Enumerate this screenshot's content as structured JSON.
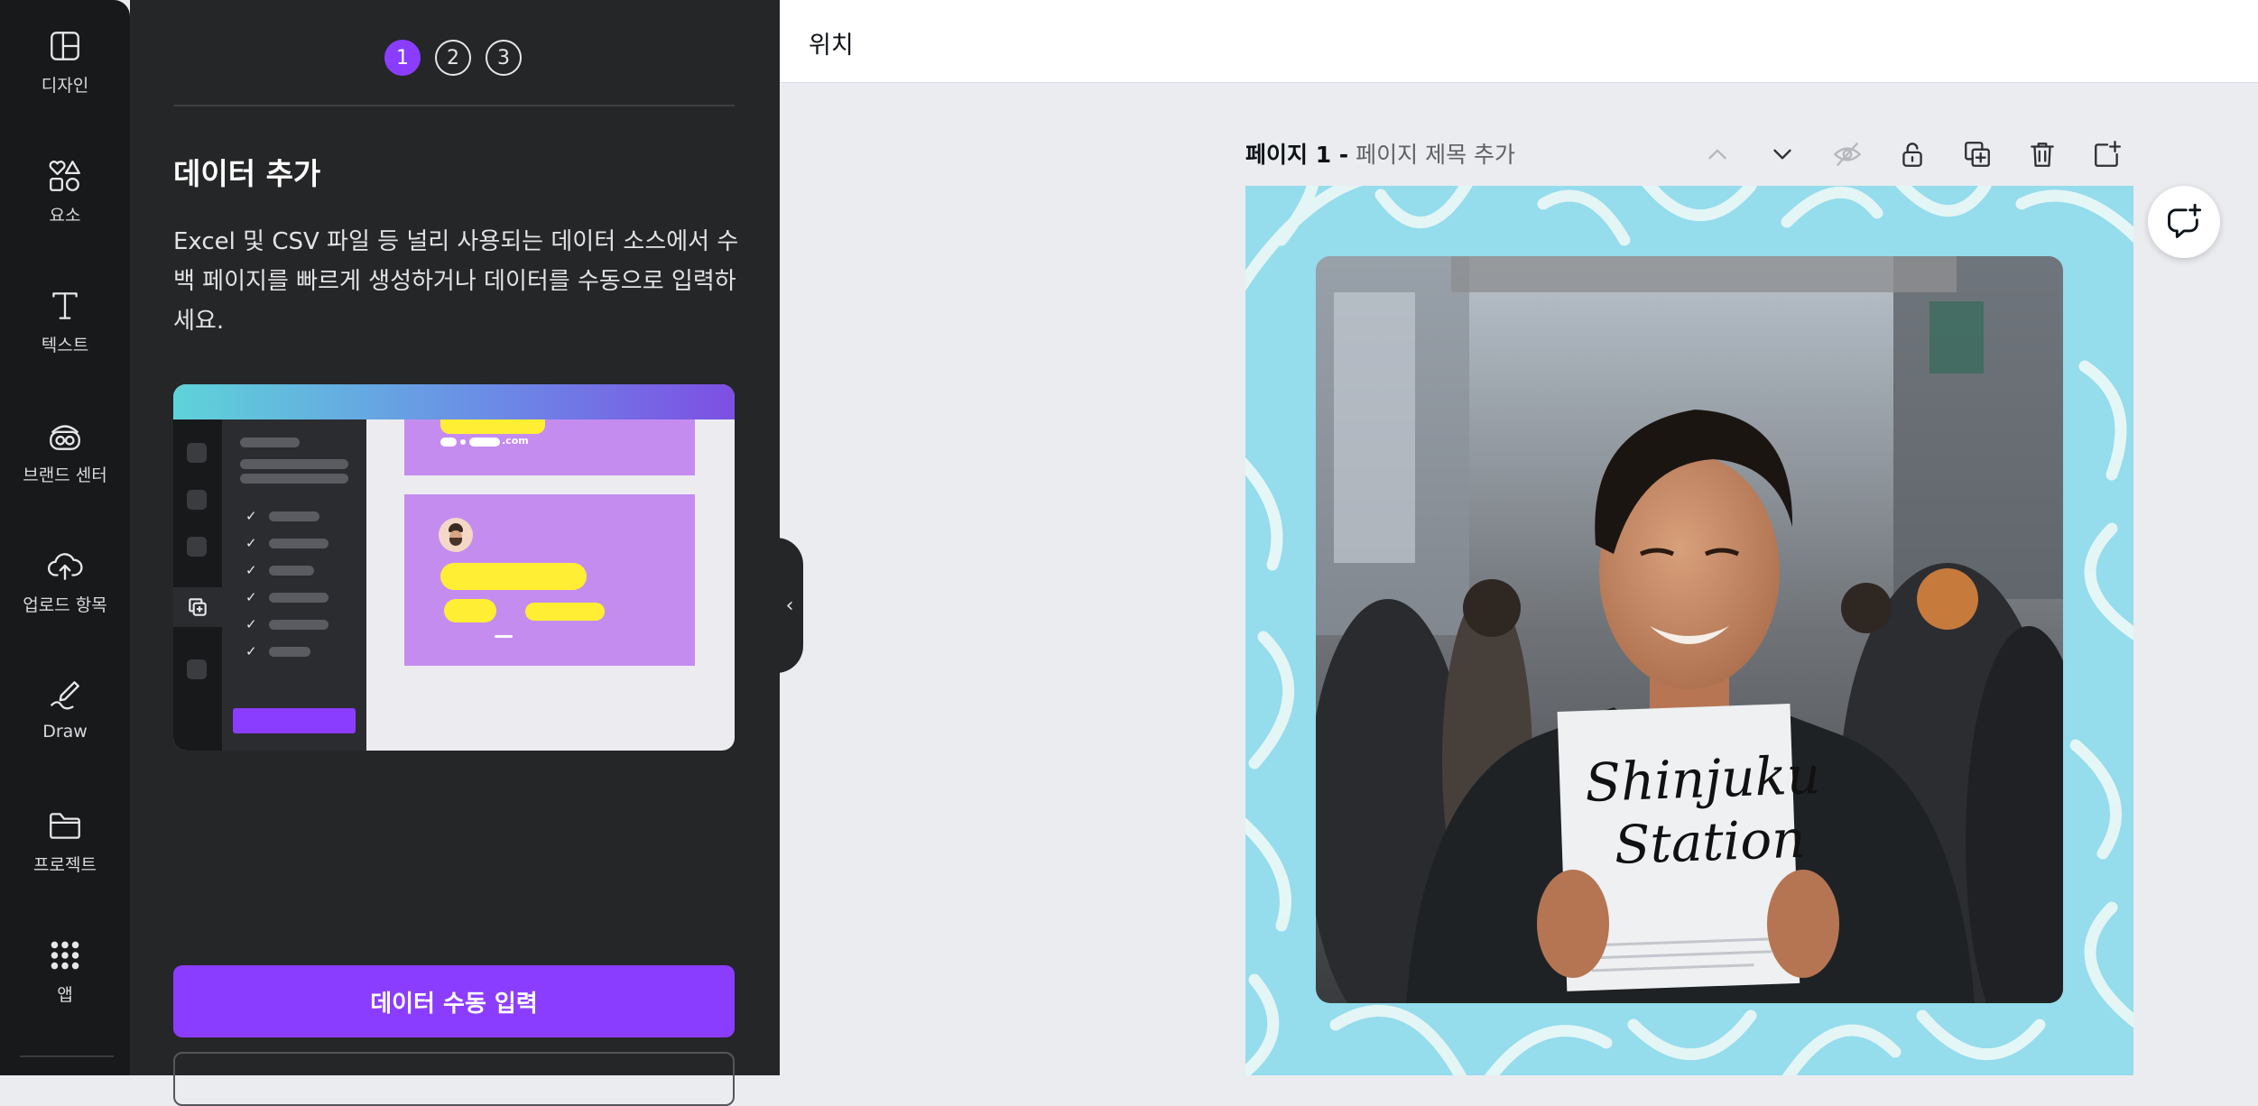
{
  "sidebar": {
    "items": [
      {
        "label": "디자인",
        "icon": "layout-icon"
      },
      {
        "label": "요소",
        "icon": "shapes-icon"
      },
      {
        "label": "텍스트",
        "icon": "text-icon"
      },
      {
        "label": "브랜드 센터",
        "icon": "brand-icon"
      },
      {
        "label": "업로드 항목",
        "icon": "cloud-upload-icon"
      },
      {
        "label": "Draw",
        "icon": "draw-icon"
      },
      {
        "label": "프로젝트",
        "icon": "folder-icon"
      },
      {
        "label": "앱",
        "icon": "apps-grid-icon"
      }
    ]
  },
  "panel": {
    "steps": [
      "1",
      "2",
      "3"
    ],
    "active_step": 1,
    "title": "데이터 추가",
    "description": "Excel 및 CSV 파일 등 널리 사용되는 데이터 소스에서 수백 페이지를 빠르게 생성하거나 데이터를 수동으로 입력하세요.",
    "primary_button": "데이터 수동 입력",
    "accent": "#8b3dff",
    "illustration_email_suffix": ".com"
  },
  "topbar": {
    "title": "위치"
  },
  "page": {
    "label": "페이지 1 -",
    "title_placeholder": "페이지 제목 추가",
    "tools": [
      "chevron-up-icon",
      "chevron-down-icon",
      "hide-icon",
      "lock-icon",
      "duplicate-icon",
      "trash-icon",
      "add-page-icon"
    ]
  },
  "design": {
    "frame_color": "#95dcec",
    "sign_line1": "Shinjuku",
    "sign_line2": "Station"
  }
}
